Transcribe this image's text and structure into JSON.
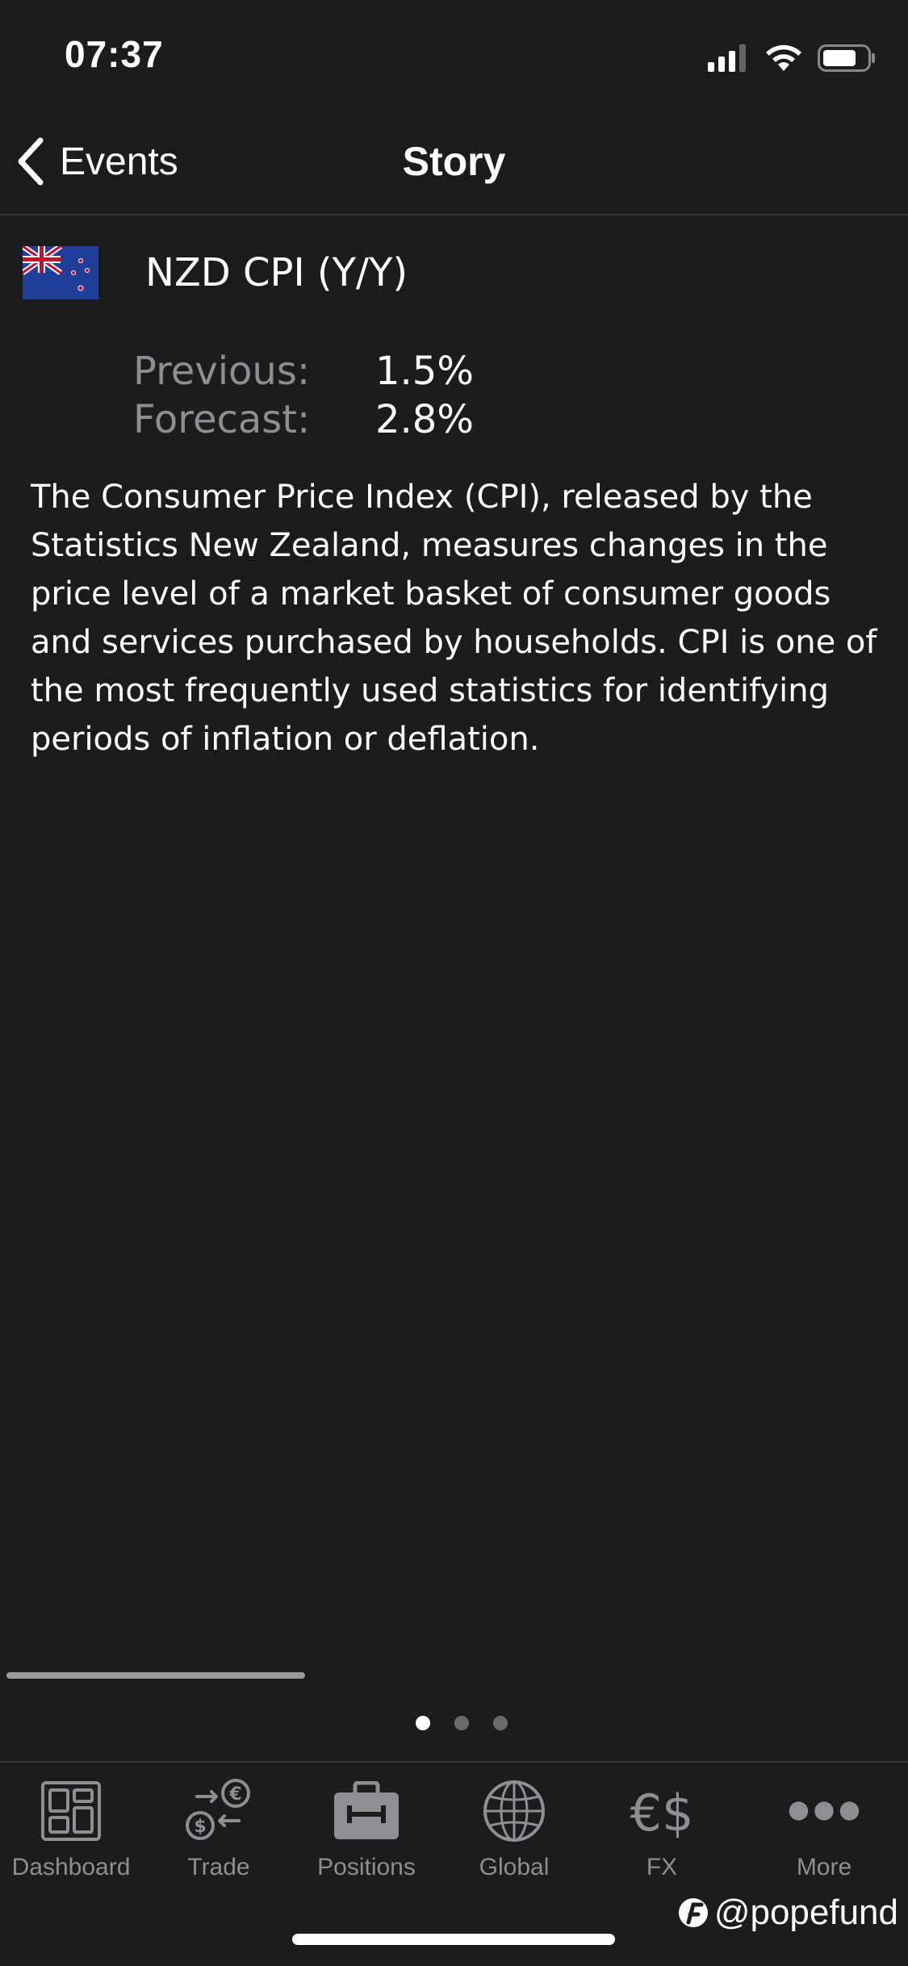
{
  "status_bar": {
    "time": "07:37",
    "signal_icon": "cellular-signal-icon",
    "wifi_icon": "wifi-icon",
    "battery_icon": "battery-icon"
  },
  "nav": {
    "back_label": "Events",
    "title": "Story"
  },
  "event": {
    "flag": "new-zealand-flag-icon",
    "title": "NZD CPI (Y/Y)",
    "stats": [
      {
        "label": "Previous:",
        "value": "1.5%"
      },
      {
        "label": "Forecast:",
        "value": "2.8%"
      }
    ],
    "description": "The Consumer Price Index (CPI), released by the Statistics New Zealand, measures changes in the price level of a market basket of consumer goods and services purchased by households. CPI is one of the most frequently used statistics for identifying periods of inflation or deflation."
  },
  "pager": {
    "page_count": 3,
    "active_index": 0
  },
  "tabs": [
    {
      "label": "Dashboard",
      "icon": "dashboard-icon"
    },
    {
      "label": "Trade",
      "icon": "trade-icon"
    },
    {
      "label": "Positions",
      "icon": "briefcase-icon"
    },
    {
      "label": "Global",
      "icon": "globe-icon"
    },
    {
      "label": "FX",
      "icon": "currency-icon"
    },
    {
      "label": "More",
      "icon": "more-icon"
    }
  ],
  "watermark": "@popefund",
  "colors": {
    "background": "#1c1c1d",
    "text_primary": "#ffffff",
    "text_secondary": "#8e8e93",
    "tab_icon": "#8e8e93"
  }
}
